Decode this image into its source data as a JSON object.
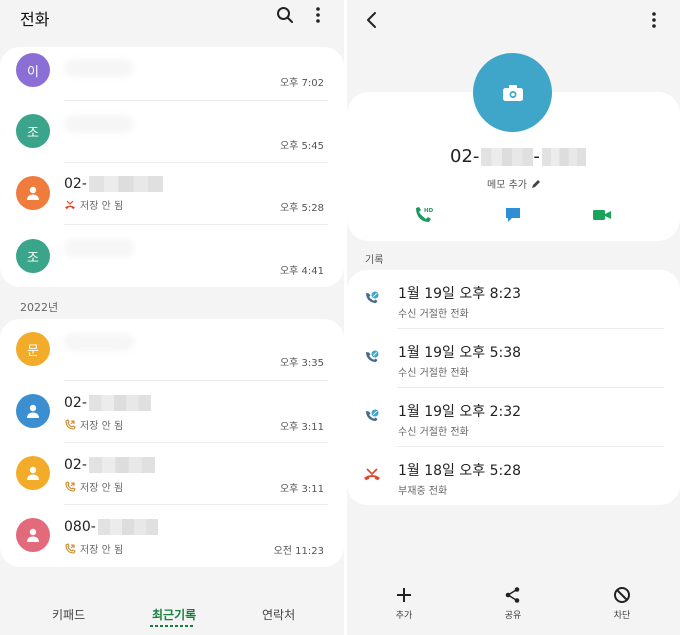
{
  "left": {
    "title": "전화",
    "recent": [
      {
        "initial": "이",
        "color": "#8b6fd6",
        "time": "오후 7:02"
      },
      {
        "initial": "조",
        "color": "#3aa58a",
        "time": "오후 5:45"
      },
      {
        "initial": "",
        "color": "#ef7b3d",
        "number_prefix": "02-",
        "status": "저장 안 됨",
        "time": "오후 5:28",
        "status_icon": "missed-call-icon"
      },
      {
        "initial": "조",
        "color": "#3aa58a",
        "time": "오후 4:41"
      }
    ],
    "section_2022": "2022년",
    "older": [
      {
        "initial": "문",
        "color": "#f2ac2a",
        "time": "오후 3:35"
      },
      {
        "initial": "",
        "color": "#3b8fd0",
        "number_prefix": "02-",
        "status": "저장 안 됨",
        "time": "오후 3:11",
        "status_icon": "outgoing-call-icon"
      },
      {
        "initial": "",
        "color": "#f2ac2a",
        "number_prefix": "02-",
        "status": "저장 안 됨",
        "time": "오후 3:11",
        "status_icon": "outgoing-call-icon"
      },
      {
        "initial": "",
        "color": "#e26a7a",
        "number_prefix": "080-",
        "status": "저장 안 됨",
        "time": "오전 11:23",
        "status_icon": "outgoing-call-icon"
      }
    ],
    "tabs": {
      "keypad": "키패드",
      "recents": "최근기록",
      "contacts": "연락처"
    }
  },
  "right": {
    "number_prefix": "02-",
    "number_mid": "-",
    "memo": "메모 추가",
    "log_label": "기록",
    "logs": [
      {
        "time": "1월 19일 오후 8:23",
        "type": "수신 거절한 전화",
        "icon": "rejected-call-icon"
      },
      {
        "time": "1월 19일 오후 5:38",
        "type": "수신 거절한 전화",
        "icon": "rejected-call-icon"
      },
      {
        "time": "1월 19일 오후 2:32",
        "type": "수신 거절한 전화",
        "icon": "rejected-call-icon"
      },
      {
        "time": "1월 18일 오후 5:28",
        "type": "부재중 전화",
        "icon": "missed-call-icon"
      }
    ],
    "actions": {
      "add": "추가",
      "share": "공유",
      "block": "차단"
    }
  },
  "colors": {
    "accent_green": "#17803d",
    "call_green": "#1a9a5c",
    "message_blue": "#2e8fd6",
    "video_green": "#1aa35b",
    "missed_red": "#e0452b",
    "avatar_blue": "#3fa6c9"
  }
}
